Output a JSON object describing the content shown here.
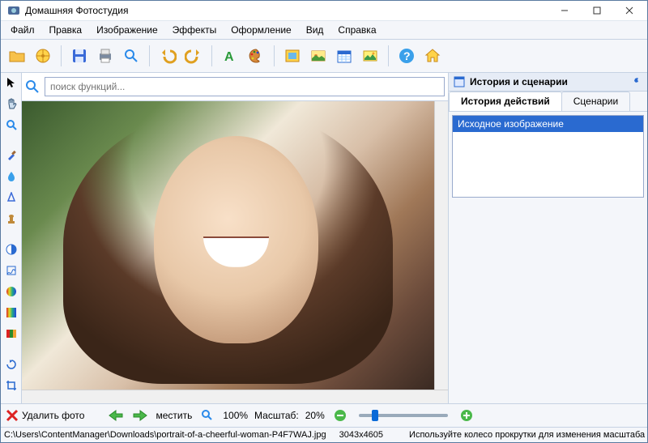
{
  "title": "Домашняя Фотостудия",
  "menu": [
    "Файл",
    "Правка",
    "Изображение",
    "Эффекты",
    "Оформление",
    "Вид",
    "Справка"
  ],
  "search": {
    "placeholder": "поиск функций..."
  },
  "right": {
    "panel_title": "История и сценарии",
    "tabs": {
      "history": "История действий",
      "scenarios": "Сценарии"
    },
    "history_items": [
      "Исходное изображение"
    ]
  },
  "bottom": {
    "delete_label": "Удалить фото",
    "fit_label": "местить",
    "zoom_100": "100%",
    "scale_label": "Масштаб:",
    "scale_value": "20%"
  },
  "status": {
    "path": "C:\\Users\\ContentManager\\Downloads\\portrait-of-a-cheerful-woman-P4F7WAJ.jpg",
    "dims": "3043x4605",
    "hint": "Используйте колесо прокрутки для изменения масштаба"
  }
}
